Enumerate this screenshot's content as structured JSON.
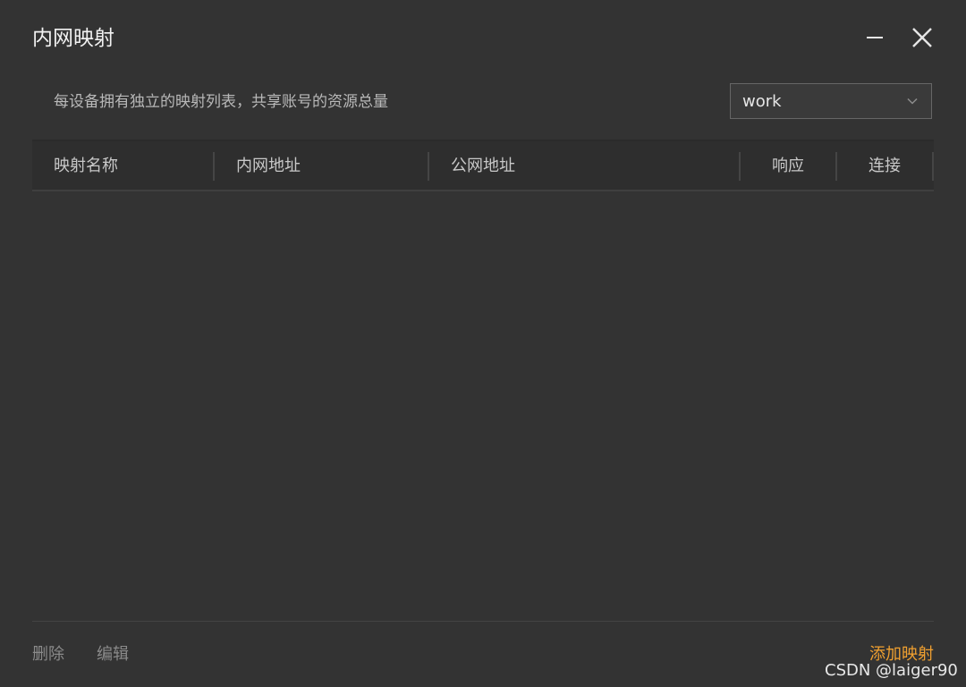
{
  "window": {
    "title": "内网映射",
    "minimize_icon": "minimize-icon",
    "close_icon": "close-icon"
  },
  "header": {
    "description": "每设备拥有独立的映射列表，共享账号的资源总量",
    "device_select": {
      "value": "work",
      "icon": "chevron-down-icon"
    }
  },
  "table": {
    "columns": [
      "映射名称",
      "内网地址",
      "公网地址",
      "响应",
      "连接"
    ],
    "rows": []
  },
  "footer": {
    "delete_label": "删除",
    "edit_label": "编辑",
    "add_label": "添加映射"
  },
  "watermark": "CSDN @laiger90",
  "colors": {
    "background": "#333333",
    "accent": "#f0a030"
  }
}
